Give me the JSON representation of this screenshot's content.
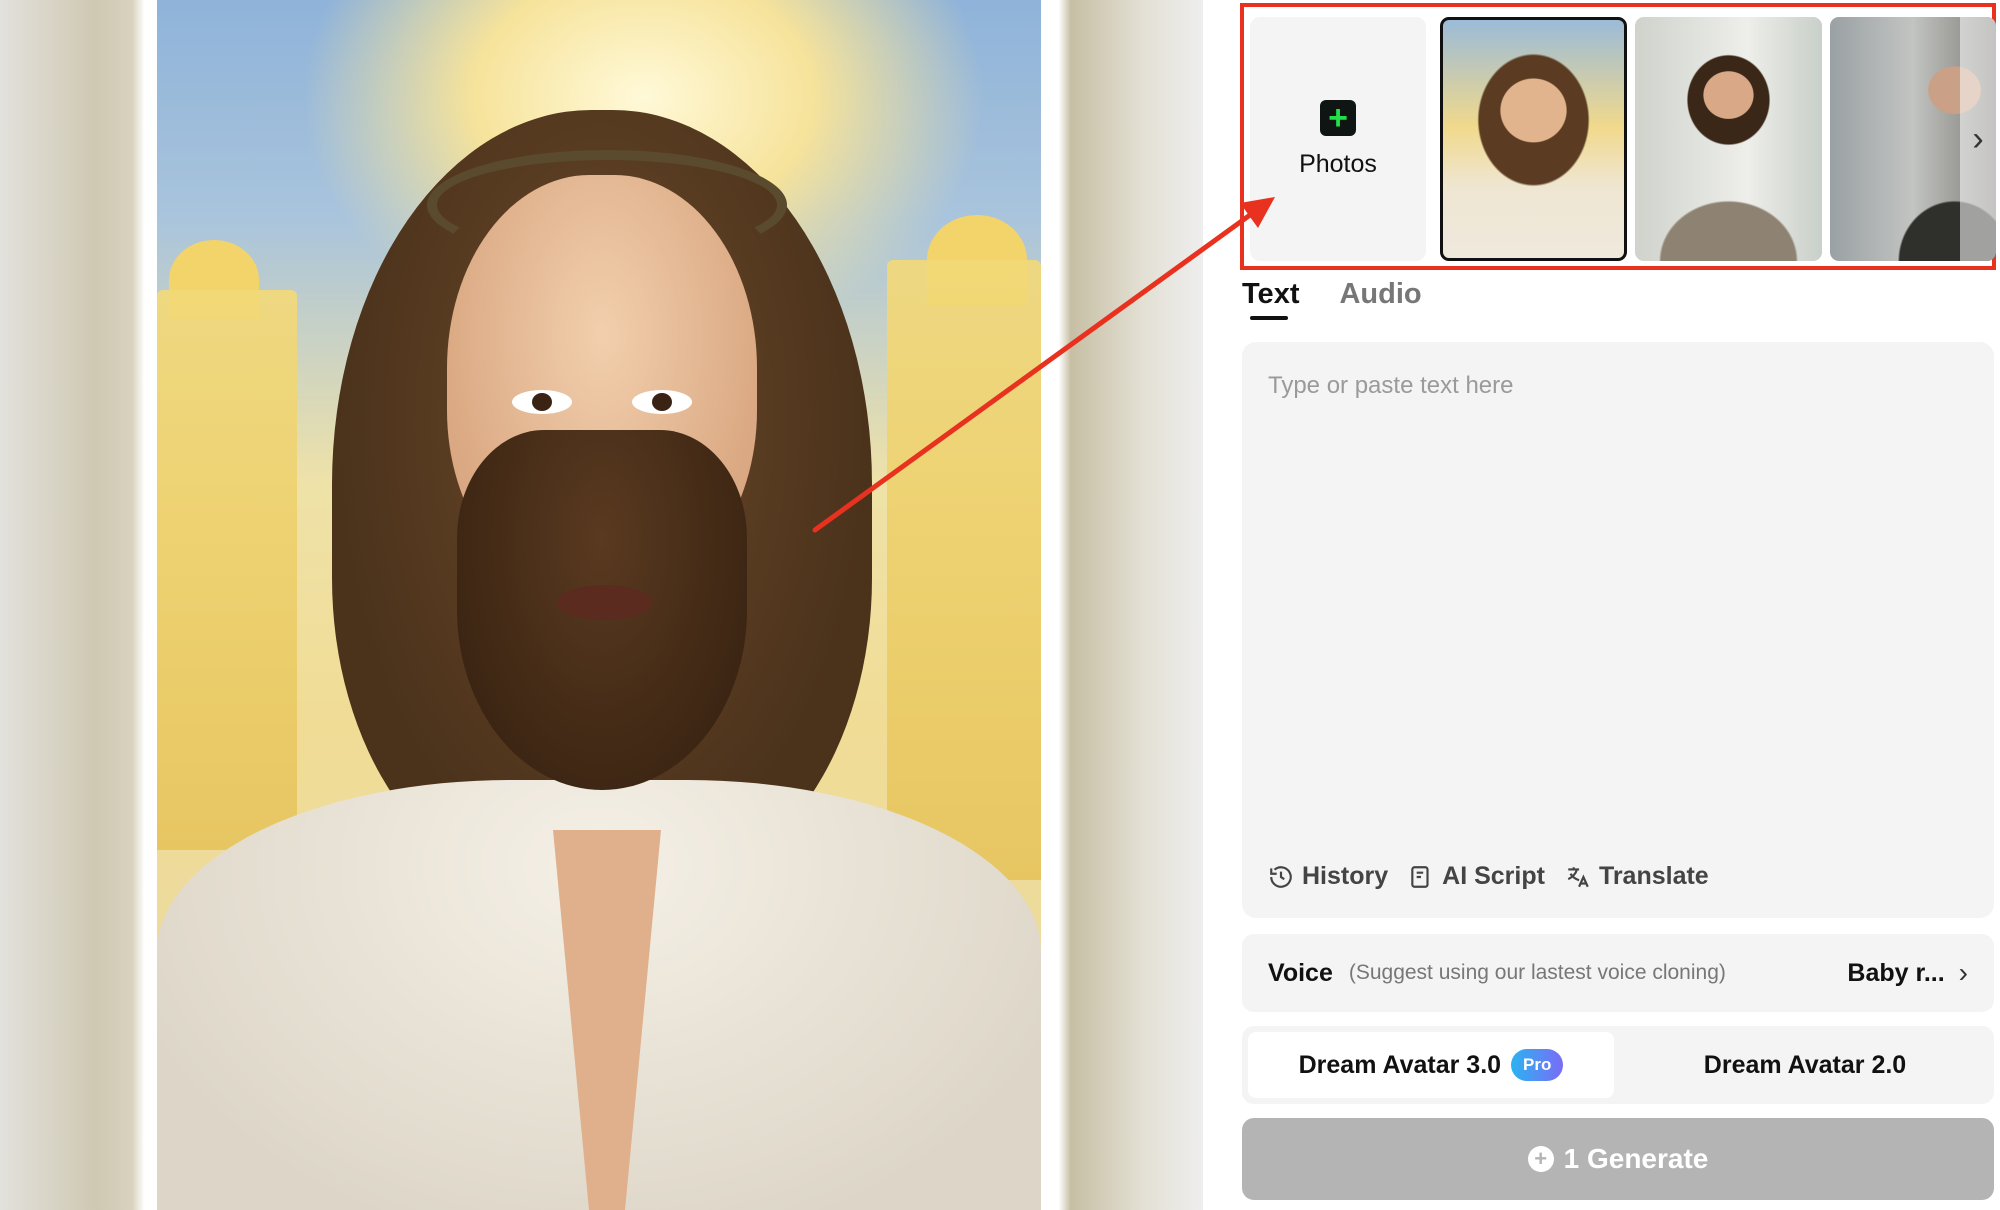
{
  "photos": {
    "add_label": "Photos",
    "add_icon": "plus-icon",
    "next_icon": "chevron-right-icon",
    "thumbnails": [
      {
        "name": "avatar-thumb-jesus",
        "selected": true
      },
      {
        "name": "avatar-thumb-woman",
        "selected": false
      },
      {
        "name": "avatar-thumb-man",
        "selected": false
      }
    ]
  },
  "tabs": [
    {
      "label": "Text",
      "active": true
    },
    {
      "label": "Audio",
      "active": false
    }
  ],
  "textbox": {
    "placeholder": "Type or paste text here",
    "tools": [
      {
        "label": "History",
        "icon": "history-icon"
      },
      {
        "label": "AI Script",
        "icon": "ai-script-icon"
      },
      {
        "label": "Translate",
        "icon": "translate-icon"
      }
    ]
  },
  "voice": {
    "label": "Voice",
    "hint": "(Suggest using our lastest voice cloning)",
    "value": "Baby r..."
  },
  "models": [
    {
      "label": "Dream Avatar 3.0",
      "badge": "Pro",
      "selected": true
    },
    {
      "label": "Dream Avatar 2.0",
      "selected": false
    }
  ],
  "generate": {
    "label": "1 Generate",
    "icon": "credit-plus-icon"
  },
  "colors": {
    "highlight": "#e8321f",
    "generate_disabled": "#b4b4b4",
    "plus_green": "#22e04a"
  }
}
